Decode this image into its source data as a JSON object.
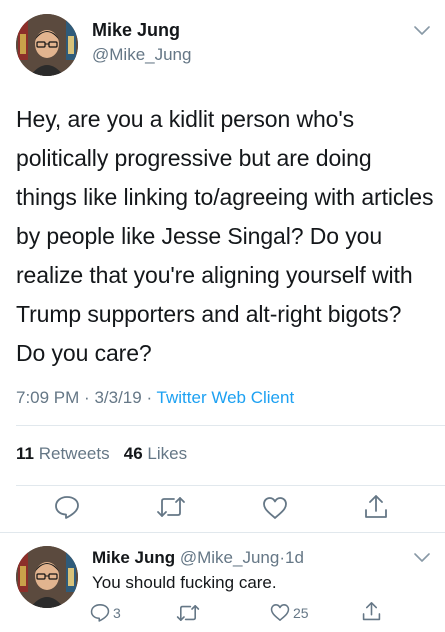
{
  "tweet": {
    "author_name": "Mike Jung",
    "author_handle": "@Mike_Jung",
    "text": "Hey, are you a kidlit person who's politically progressive but are doing things like linking to/agreeing with articles by people like Jesse Singal? Do you realize that you're aligning yourself with Trump supporters and alt-right bigots? Do you care?",
    "time": "7:09 PM",
    "date": "3/3/19",
    "separator": "·",
    "client": "Twitter Web Client",
    "retweets_count": "11",
    "retweets_label": "Retweets",
    "likes_count": "46",
    "likes_label": "Likes",
    "icons": [
      "reply-icon",
      "retweet-icon",
      "like-icon",
      "share-icon",
      "chevron-down-icon"
    ]
  },
  "reply": {
    "author_name": "Mike Jung",
    "author_handle": "@Mike_Jung",
    "separator": "·",
    "time": "1d",
    "text": "You should fucking care.",
    "reply_count": "3",
    "like_count": "25"
  },
  "colors": {
    "text": "#14171a",
    "secondary": "#657786",
    "link": "#1da1f2",
    "divider": "#e1e8ed"
  }
}
